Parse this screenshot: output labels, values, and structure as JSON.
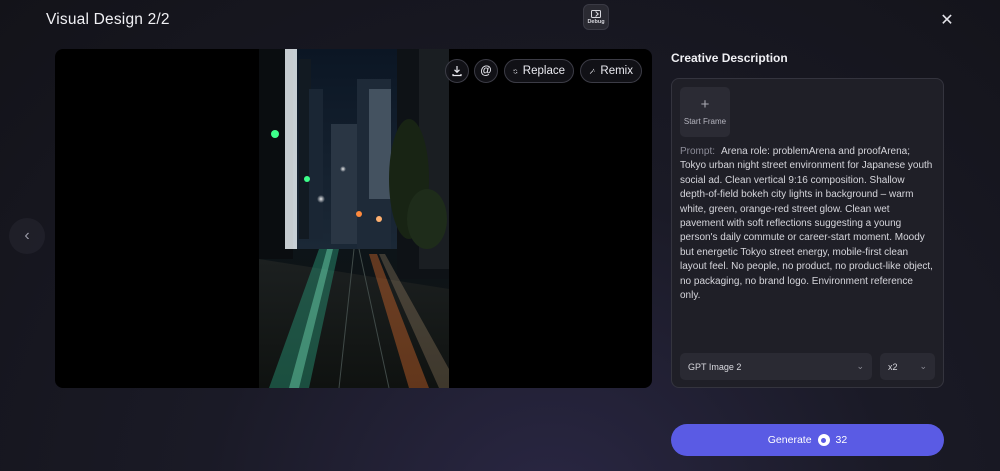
{
  "header": {
    "title": "Visual Design 2/2",
    "debug_label": "Debug",
    "close_glyph": "✕"
  },
  "preview": {
    "tools": {
      "download_icon": "download-icon",
      "mention_glyph": "@",
      "replace_label": "Replace",
      "remix_label": "Remix"
    },
    "nav_prev_glyph": "‹"
  },
  "side": {
    "title": "Creative Description",
    "start_frame": {
      "plus": "+",
      "label": "Start Frame"
    },
    "prompt_label": "Prompt:",
    "prompt_text": "Arena role: problemArena and proofArena; Tokyo urban night street environment for Japanese youth social ad. Clean vertical 9:16 composition. Shallow depth-of-field bokeh city lights in background – warm white, green, orange-red street glow. Clean wet pavement with soft reflections suggesting a young person's daily commute or career-start moment. Moody but energetic Tokyo street energy, mobile-first clean layout feel. No people, no product, no product-like object, no packaging, no brand logo. Environment reference only.",
    "model_select": {
      "value": "GPT Image 2"
    },
    "count_select": {
      "value": "x2"
    }
  },
  "generate": {
    "label": "Generate",
    "credits": "32"
  },
  "colors": {
    "accent": "#5a5be4",
    "panel_bg": "#1f1f27",
    "page_bg": "#16161e"
  }
}
